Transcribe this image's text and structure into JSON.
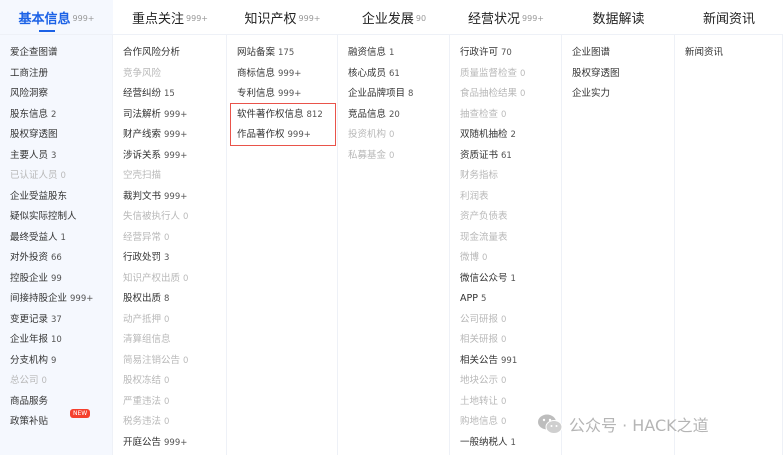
{
  "tabs": [
    {
      "label": "基本信息",
      "count": "999+",
      "active": true
    },
    {
      "label": "重点关注",
      "count": "999+"
    },
    {
      "label": "知识产权",
      "count": "999+"
    },
    {
      "label": "企业发展",
      "count": "90"
    },
    {
      "label": "经营状况",
      "count": "999+"
    },
    {
      "label": "数据解读",
      "count": ""
    },
    {
      "label": "新闻资讯",
      "count": ""
    }
  ],
  "columns": [
    [
      {
        "label": "爱企查图谱"
      },
      {
        "label": "工商注册"
      },
      {
        "label": "风险洞察"
      },
      {
        "label": "股东信息",
        "count": "2"
      },
      {
        "label": "股权穿透图"
      },
      {
        "label": "主要人员",
        "count": "3"
      },
      {
        "label": "已认证人员",
        "count": "0",
        "dim": true
      },
      {
        "label": "企业受益股东"
      },
      {
        "label": "疑似实际控制人"
      },
      {
        "label": "最终受益人",
        "count": "1"
      },
      {
        "label": "对外投资",
        "count": "66"
      },
      {
        "label": "控股企业",
        "count": "99"
      },
      {
        "label": "间接持股企业",
        "count": "999+"
      },
      {
        "label": "变更记录",
        "count": "37"
      },
      {
        "label": "企业年报",
        "count": "10"
      },
      {
        "label": "分支机构",
        "count": "9"
      },
      {
        "label": "总公司",
        "count": "0",
        "dim": true
      },
      {
        "label": "商品服务"
      },
      {
        "label": "政策补贴",
        "badge": "NEW"
      }
    ],
    [
      {
        "label": "合作风险分析"
      },
      {
        "label": "竞争风险",
        "dim": true
      },
      {
        "label": "经营纠纷",
        "count": "15"
      },
      {
        "label": "司法解析",
        "count": "999+"
      },
      {
        "label": "财产线索",
        "count": "999+"
      },
      {
        "label": "涉诉关系",
        "count": "999+"
      },
      {
        "label": "空壳扫描",
        "dim": true
      },
      {
        "label": "裁判文书",
        "count": "999+"
      },
      {
        "label": "失信被执行人",
        "count": "0",
        "dim": true
      },
      {
        "label": "经营异常",
        "count": "0",
        "dim": true
      },
      {
        "label": "行政处罚",
        "count": "3"
      },
      {
        "label": "知识产权出质",
        "count": "0",
        "dim": true
      },
      {
        "label": "股权出质",
        "count": "8"
      },
      {
        "label": "动产抵押",
        "count": "0",
        "dim": true
      },
      {
        "label": "清算组信息",
        "dim": true
      },
      {
        "label": "简易注销公告",
        "count": "0",
        "dim": true
      },
      {
        "label": "股权冻结",
        "count": "0",
        "dim": true
      },
      {
        "label": "严重违法",
        "count": "0",
        "dim": true
      },
      {
        "label": "税务违法",
        "count": "0",
        "dim": true
      },
      {
        "label": "开庭公告",
        "count": "999+"
      }
    ],
    [
      {
        "label": "网站备案",
        "count": "175"
      },
      {
        "label": "商标信息",
        "count": "999+"
      },
      {
        "label": "专利信息",
        "count": "999+"
      },
      {
        "label": "软件著作权信息",
        "count": "812"
      },
      {
        "label": "作品著作权",
        "count": "999+"
      }
    ],
    [
      {
        "label": "融资信息",
        "count": "1"
      },
      {
        "label": "核心成员",
        "count": "61"
      },
      {
        "label": "企业品牌项目",
        "count": "8"
      },
      {
        "label": "竞品信息",
        "count": "20"
      },
      {
        "label": "投资机构",
        "count": "0",
        "dim": true
      },
      {
        "label": "私募基金",
        "count": "0",
        "dim": true
      }
    ],
    [
      {
        "label": "行政许可",
        "count": "70"
      },
      {
        "label": "质量监督检查",
        "count": "0",
        "dim": true
      },
      {
        "label": "食品抽检结果",
        "count": "0",
        "dim": true
      },
      {
        "label": "抽查检查",
        "count": "0",
        "dim": true
      },
      {
        "label": "双随机抽检",
        "count": "2"
      },
      {
        "label": "资质证书",
        "count": "61"
      },
      {
        "label": "财务指标",
        "dim": true
      },
      {
        "label": "利润表",
        "dim": true
      },
      {
        "label": "资产负债表",
        "dim": true
      },
      {
        "label": "现金流量表",
        "dim": true
      },
      {
        "label": "微博",
        "count": "0",
        "dim": true
      },
      {
        "label": "微信公众号",
        "count": "1"
      },
      {
        "label": "APP",
        "count": "5"
      },
      {
        "label": "公司研报",
        "count": "0",
        "dim": true
      },
      {
        "label": "相关研报",
        "count": "0",
        "dim": true
      },
      {
        "label": "相关公告",
        "count": "991"
      },
      {
        "label": "地块公示",
        "count": "0",
        "dim": true
      },
      {
        "label": "土地转让",
        "count": "0",
        "dim": true
      },
      {
        "label": "购地信息",
        "count": "0",
        "dim": true
      },
      {
        "label": "一般纳税人",
        "count": "1"
      }
    ],
    [
      {
        "label": "企业图谱"
      },
      {
        "label": "股权穿透图"
      },
      {
        "label": "企业实力"
      }
    ],
    [
      {
        "label": "新闻资讯"
      }
    ]
  ],
  "watermark": "公众号 · HACK之道",
  "colors": {
    "accent": "#1c62e6",
    "highlight": "#e9534a",
    "badge": "#f5402d"
  }
}
